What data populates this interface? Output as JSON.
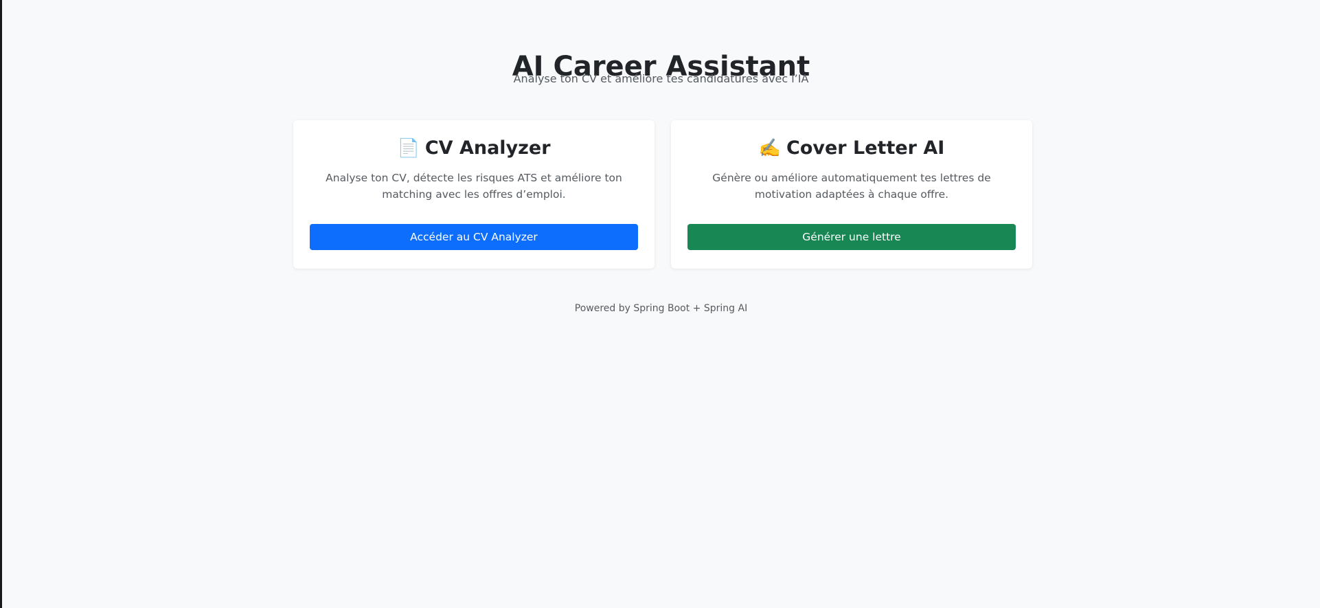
{
  "header": {
    "title": "AI Career Assistant",
    "subtitle": "Analyse ton CV et améliore tes candidatures avec l’IA"
  },
  "cards": [
    {
      "icon": "📄",
      "icon_name": "document-icon",
      "title": "CV Analyzer",
      "description": "Analyse ton CV, détecte les risques ATS et améliore ton matching avec les offres d’emploi.",
      "button_label": "Accéder au CV Analyzer",
      "button_color": "#0d6efd"
    },
    {
      "icon": "✍️",
      "icon_name": "writing-hand-icon",
      "title": "Cover Letter AI",
      "description": "Génère ou améliore automatiquement tes lettres de motivation adaptées à chaque offre.",
      "button_label": "Générer une lettre",
      "button_color": "#198754"
    }
  ],
  "footer": {
    "text": "Powered by Spring Boot + Spring AI"
  }
}
